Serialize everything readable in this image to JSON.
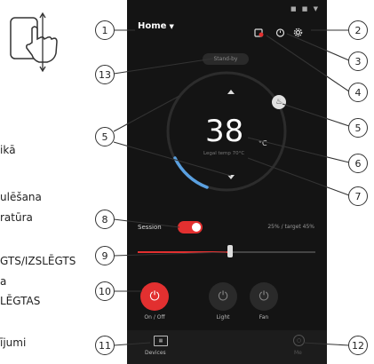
{
  "manual": {
    "lines": [
      "ikā",
      "ulēšana",
      "ratūra",
      "GTS/IZSLĒGTS",
      "a",
      "LĒGTAS",
      "ījumi"
    ]
  },
  "callouts": [
    "1",
    "2",
    "3",
    "4",
    "5",
    "5",
    "6",
    "7",
    "8",
    "9",
    "10",
    "11",
    "12",
    "13"
  ],
  "app": {
    "location": "Home",
    "standby_label": "Stand-by",
    "temperature": "38",
    "unit": "°C",
    "sub_label": "Legal temp 70°C",
    "session_label": "Session",
    "target_label": "25% / target 45%",
    "controls": [
      {
        "label": "On / Off",
        "active": true
      },
      {
        "label": "Light",
        "active": false
      },
      {
        "label": "Fan",
        "active": false
      }
    ],
    "nav": {
      "devices": "Devices",
      "me": "Me"
    },
    "slider_fraction": 0.52,
    "accent": "#e23030"
  }
}
